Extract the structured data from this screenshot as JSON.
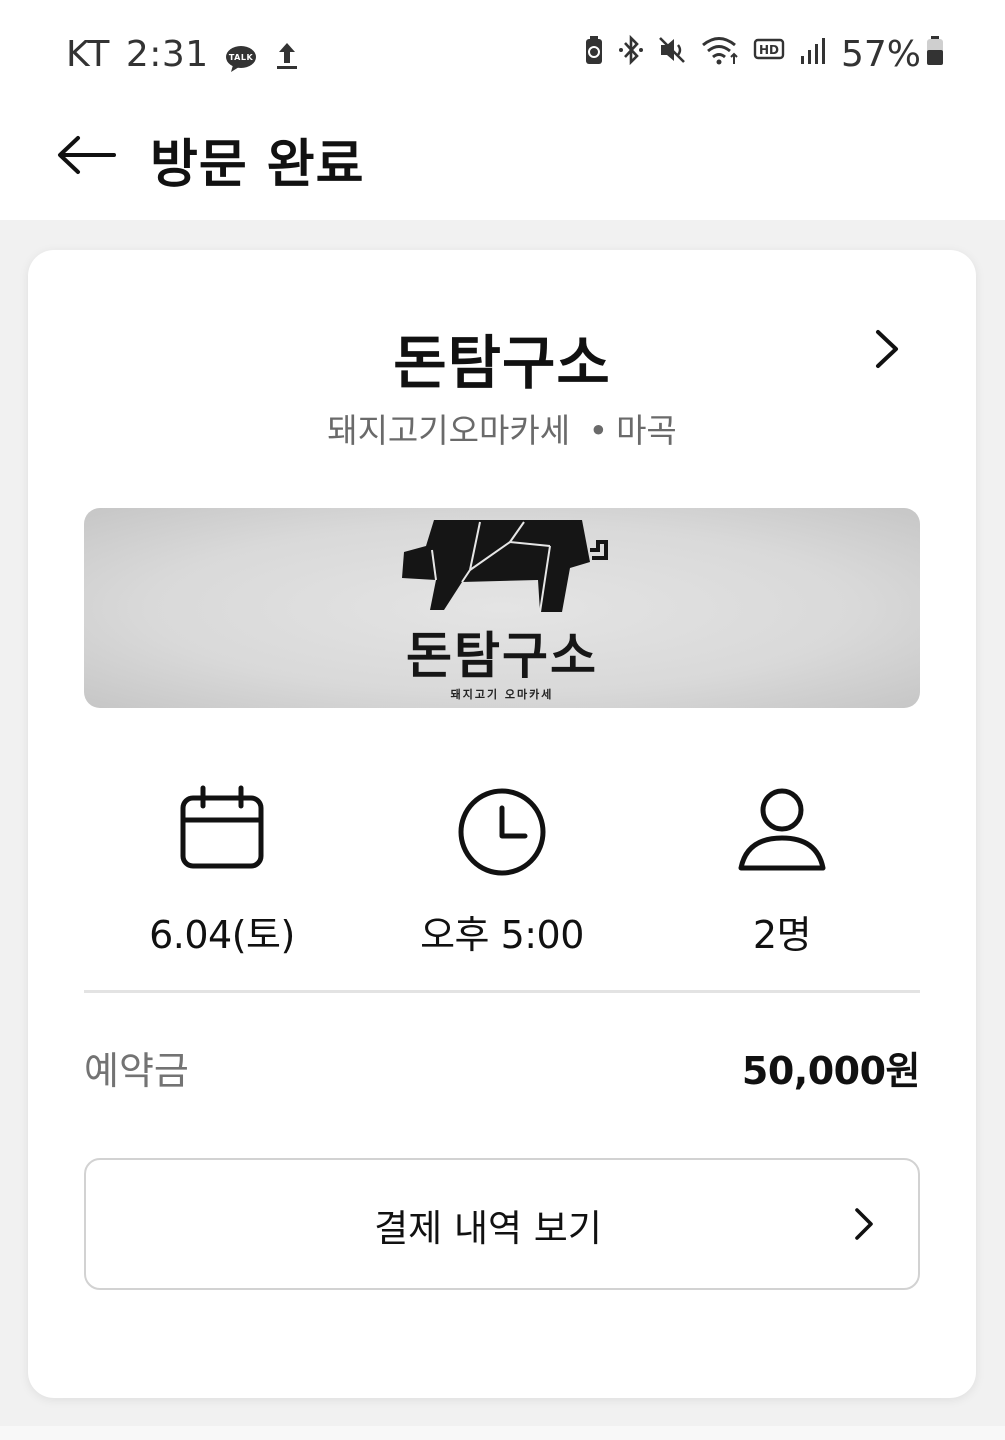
{
  "status_bar": {
    "carrier": "KT",
    "time": "2:31",
    "notification_icons": [
      "kakaotalk-icon",
      "upload-icon"
    ],
    "system_icons": [
      "battery-saver-icon",
      "bluetooth-icon",
      "mute-icon",
      "wifi-icon",
      "hd-voice-icon",
      "signal-icon"
    ],
    "battery_percent": "57%"
  },
  "header": {
    "back_icon": "arrow-left-icon",
    "title": "방문 완료"
  },
  "restaurant": {
    "name": "돈탐구소",
    "category": "돼지고기오마카세",
    "separator": "•",
    "location": "마곡",
    "banner": {
      "logo": "pig-logo",
      "title": "돈탐구소",
      "subtitle": "돼지고기 오마카세"
    }
  },
  "reservation": {
    "date": "6.04(토)",
    "time": "오후 5:00",
    "party_size": "2명",
    "icons": [
      "calendar-icon",
      "clock-icon",
      "person-icon"
    ]
  },
  "deposit": {
    "label": "예약금",
    "amount": "50,000원"
  },
  "payment_button": {
    "label": "결제 내역 보기"
  },
  "colors": {
    "background": "#f1f1f1",
    "card": "#ffffff",
    "primary_text": "#111111",
    "secondary_text": "#6a6a6a",
    "border": "#d2d2d2"
  }
}
